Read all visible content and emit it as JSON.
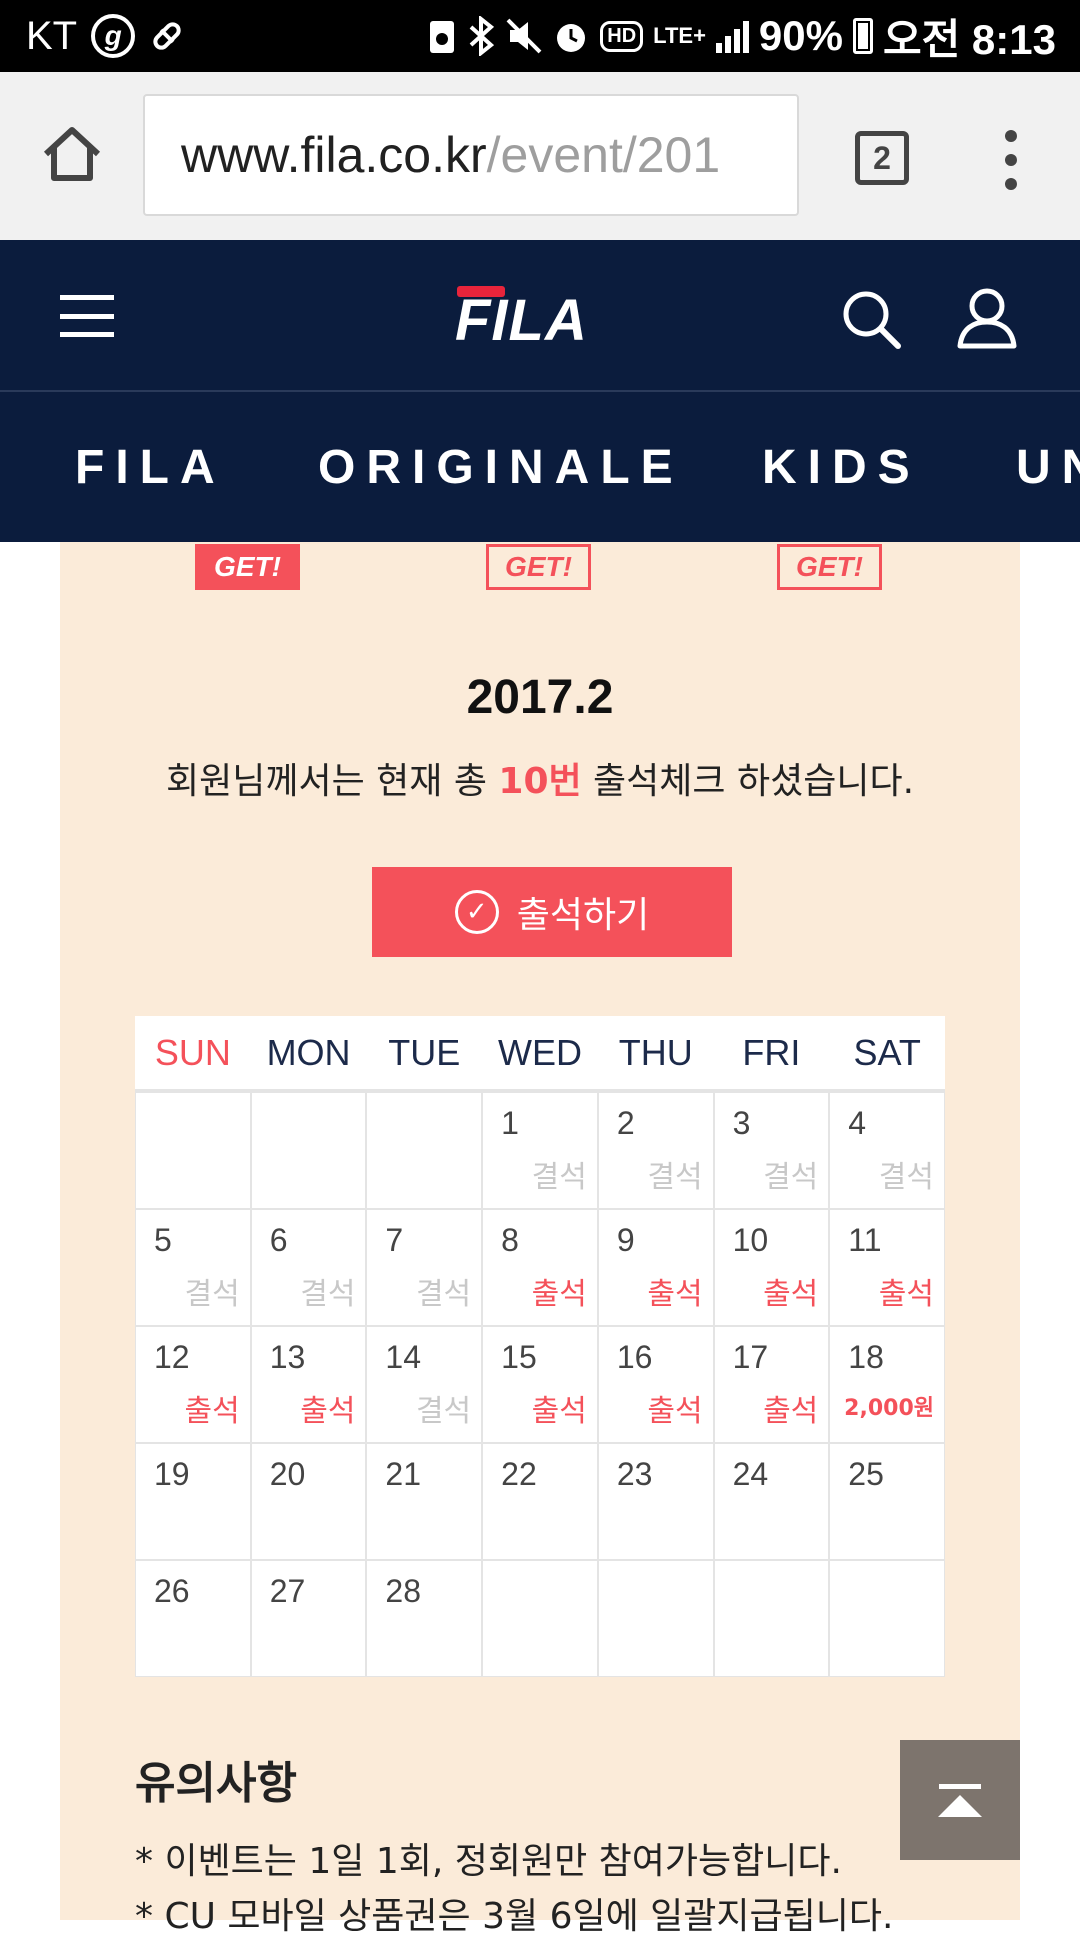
{
  "status_bar": {
    "carrier": "KT",
    "g_icon_label": "g",
    "battery_percent": "90%",
    "time": "오전 8:13",
    "hd_label": "HD",
    "lte_label": "LTE+"
  },
  "browser": {
    "url_host": "www.fila.co.kr",
    "url_path": "/event/201",
    "tab_count": "2"
  },
  "nav": {
    "categories": [
      "FILA",
      "ORIGINALE",
      "KIDS",
      "UN"
    ]
  },
  "badges": [
    "GET!",
    "GET!",
    "GET!"
  ],
  "event": {
    "month": "2017.2",
    "message_prefix": "회원님께서는 현재 총 ",
    "attendance_count": "10번",
    "message_suffix": " 출석체크 하셨습니다.",
    "checkin_label": "출석하기"
  },
  "calendar": {
    "weekdays": [
      "SUN",
      "MON",
      "TUE",
      "WED",
      "THU",
      "FRI",
      "SAT"
    ],
    "weeks": [
      [
        {
          "day": "",
          "status": ""
        },
        {
          "day": "",
          "status": ""
        },
        {
          "day": "",
          "status": ""
        },
        {
          "day": "1",
          "status": "결석"
        },
        {
          "day": "2",
          "status": "결석"
        },
        {
          "day": "3",
          "status": "결석"
        },
        {
          "day": "4",
          "status": "결석"
        }
      ],
      [
        {
          "day": "5",
          "status": "결석"
        },
        {
          "day": "6",
          "status": "결석"
        },
        {
          "day": "7",
          "status": "결석"
        },
        {
          "day": "8",
          "status": "출석"
        },
        {
          "day": "9",
          "status": "출석"
        },
        {
          "day": "10",
          "status": "출석"
        },
        {
          "day": "11",
          "status": "출석"
        }
      ],
      [
        {
          "day": "12",
          "status": "출석"
        },
        {
          "day": "13",
          "status": "출석"
        },
        {
          "day": "14",
          "status": "결석"
        },
        {
          "day": "15",
          "status": "출석"
        },
        {
          "day": "16",
          "status": "출석"
        },
        {
          "day": "17",
          "status": "출석"
        },
        {
          "day": "18",
          "status": "2,000원"
        }
      ],
      [
        {
          "day": "19",
          "status": ""
        },
        {
          "day": "20",
          "status": ""
        },
        {
          "day": "21",
          "status": ""
        },
        {
          "day": "22",
          "status": ""
        },
        {
          "day": "23",
          "status": ""
        },
        {
          "day": "24",
          "status": ""
        },
        {
          "day": "25",
          "status": ""
        }
      ],
      [
        {
          "day": "26",
          "status": ""
        },
        {
          "day": "27",
          "status": ""
        },
        {
          "day": "28",
          "status": ""
        },
        {
          "day": "",
          "status": ""
        },
        {
          "day": "",
          "status": ""
        },
        {
          "day": "",
          "status": ""
        },
        {
          "day": "",
          "status": ""
        }
      ]
    ]
  },
  "notice": {
    "title": "유의사항",
    "items": [
      "*  이벤트는 1일 1회, 정회원만 참여가능합니다.",
      "*  CU 모바일 상품권은 3월 6일에 일괄지급됩니다."
    ]
  },
  "colors": {
    "navy": "#0b1c3d",
    "accent_red": "#f4515a",
    "panel_beige": "#fbebd9",
    "absent_gray": "#c8c8c8"
  }
}
